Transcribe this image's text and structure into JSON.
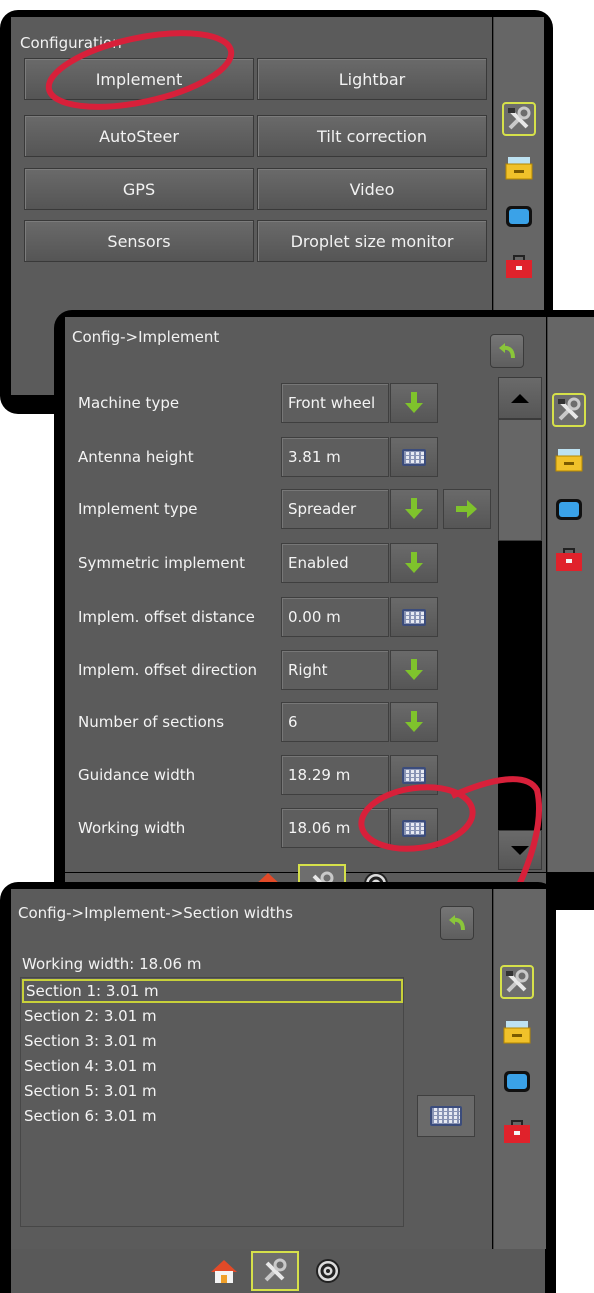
{
  "colors": {
    "annotation_red": "#d8203a",
    "active_border": "#d6e14a",
    "screen_bg": "#5b5b5b",
    "arrow_green": "#7fc32c"
  },
  "panel1": {
    "title": "Configuration",
    "buttons": [
      "Implement",
      "Lightbar",
      "AutoSteer",
      "Tilt correction",
      "GPS",
      "Video",
      "Sensors",
      "Droplet size monitor"
    ]
  },
  "panel2": {
    "title": "Config->Implement",
    "rows": [
      {
        "label": "Machine type",
        "value": "Front wheel",
        "control": "arrow-down"
      },
      {
        "label": "Antenna height",
        "value": "3.81 m",
        "control": "keyboard"
      },
      {
        "label": "Implement type",
        "value": "Spreader",
        "control": "arrow-down",
        "extra": "arrow-right"
      },
      {
        "label": "Symmetric implement",
        "value": "Enabled",
        "control": "arrow-down"
      },
      {
        "label": "Implem. offset distance",
        "value": "0.00 m",
        "control": "keyboard"
      },
      {
        "label": "Implem. offset direction",
        "value": "Right",
        "control": "arrow-down"
      },
      {
        "label": "Number of sections",
        "value": "6",
        "control": "arrow-down"
      },
      {
        "label": "Guidance width",
        "value": "18.29 m",
        "control": "keyboard"
      },
      {
        "label": "Working width",
        "value": "18.06 m",
        "control": "keyboard"
      }
    ]
  },
  "panel3": {
    "title": "Config->Implement->Section widths",
    "working_width": "Working width: 18.06 m",
    "sections": [
      "Section 1: 3.01 m",
      "Section 2: 3.01 m",
      "Section 3: 3.01 m",
      "Section 4: 3.01 m",
      "Section 5: 3.01 m",
      "Section 6: 3.01 m"
    ]
  },
  "side_icons": [
    "tools-icon",
    "drawer-icon",
    "screen-icon",
    "toolbox-icon"
  ],
  "bottom_tabs": [
    "home-icon",
    "tools-icon",
    "gauge-icon"
  ]
}
